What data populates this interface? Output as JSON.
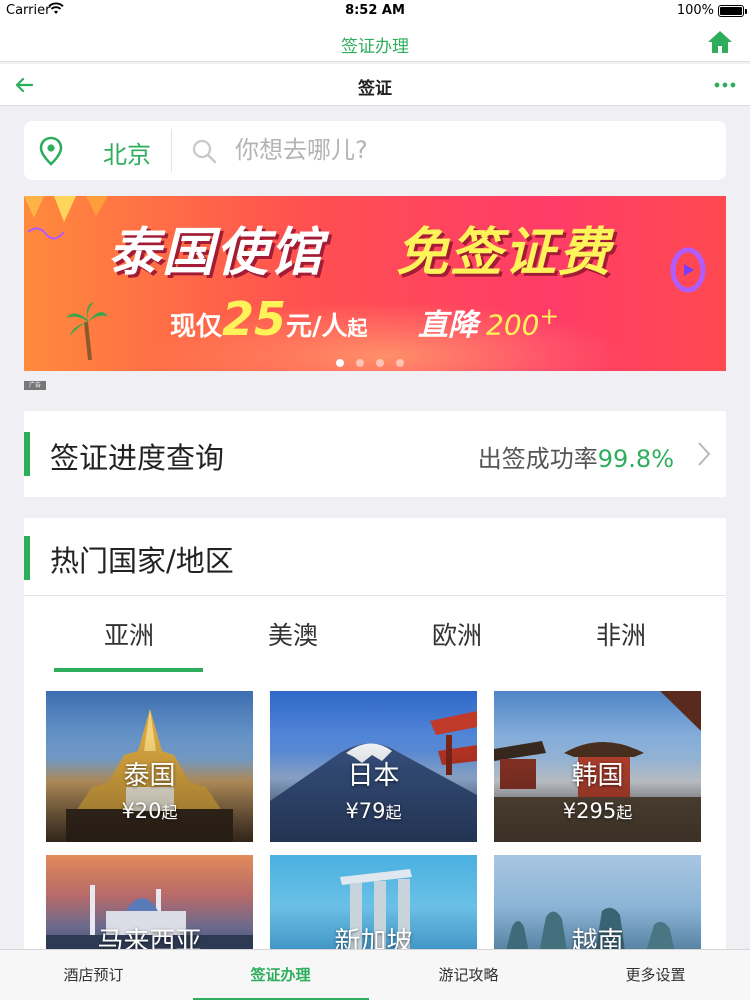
{
  "status_bar": {
    "carrier": "Carrier",
    "time": "8:52 AM",
    "battery": "100%"
  },
  "app_bar": {
    "title": "签证办理",
    "home_icon": "home-icon"
  },
  "nav_bar": {
    "title": "签证",
    "back_icon": "arrow-left-icon",
    "more_icon": "more-dots-icon"
  },
  "search": {
    "city": "北京",
    "placeholder": "你想去哪儿?"
  },
  "banner": {
    "headline_left": "泰国使馆",
    "headline_right": "免签证费",
    "sub_prefix": "现仅",
    "sub_price": "25",
    "sub_unit": "元/人",
    "sub_suffix": "起",
    "drop_text": "直降",
    "drop_amount": "200",
    "drop_plus": "+",
    "ad_tag": "广告",
    "slides": 4,
    "active_slide": 1
  },
  "progress": {
    "label": "签证进度查询",
    "rate_prefix": "出签成功率",
    "rate_value": "99.8%"
  },
  "hot": {
    "title": "热门国家/地区",
    "tabs": [
      "亚洲",
      "美澳",
      "欧洲",
      "非洲"
    ],
    "active_tab": 0,
    "destinations": [
      {
        "name": "泰国",
        "price": "¥20",
        "suffix": "起"
      },
      {
        "name": "日本",
        "price": "¥79",
        "suffix": "起"
      },
      {
        "name": "韩国",
        "price": "¥295",
        "suffix": "起"
      },
      {
        "name": "马来西亚",
        "price": "",
        "suffix": ""
      },
      {
        "name": "新加坡",
        "price": "",
        "suffix": ""
      },
      {
        "name": "越南",
        "price": "",
        "suffix": ""
      }
    ]
  },
  "tab_bar": {
    "items": [
      "酒店预订",
      "签证办理",
      "游记攻略",
      "更多设置"
    ],
    "active": 1
  },
  "colors": {
    "accent": "#2eae5c",
    "banner_yellow": "#fff35a"
  }
}
